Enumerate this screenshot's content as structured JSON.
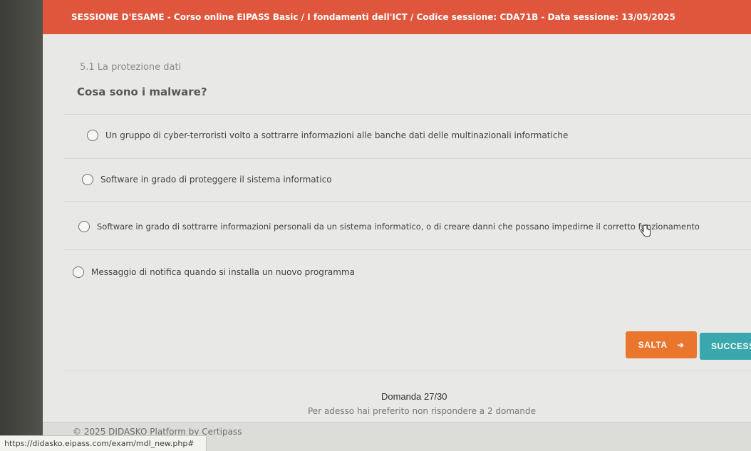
{
  "session": {
    "text": "SESSIONE D'ESAME - Corso online EIPASS Basic / I fondamenti dell'ICT / Codice sessione: CDA71B - Data sessione: 13/05/2025"
  },
  "exam": {
    "section": "5.1 La protezione dati",
    "question": "Cosa sono i malware?",
    "answers": [
      "Un gruppo di cyber-terroristi volto a sottrarre informazioni alle banche dati delle multinazionali informatiche",
      "Software in grado di proteggere il sistema informatico",
      "Software in grado di sottrarre informazioni personali da un sistema informatico, o di creare danni che possano impedirne il corretto funzionamento",
      "Messaggio di notifica quando si installa un nuovo programma"
    ],
    "skip_label": "SALTA",
    "success_label": "SUCCESS",
    "counter": "Domanda 27/30",
    "skipped_note": "Per adesso hai preferito non rispondere a 2 domande"
  },
  "footer": {
    "copyright": "© 2025  DIDASKO Platform by Certipass"
  },
  "status_bar": {
    "url": "https://didasko.eipass.com/exam/mdl_new.php#"
  },
  "colors": {
    "session_bar": "#e0563c",
    "skip_button": "#e9762c",
    "success_button": "#3aa7ad"
  },
  "icons": [
    "radio-unchecked",
    "pointer-hand",
    "arrow-right"
  ]
}
